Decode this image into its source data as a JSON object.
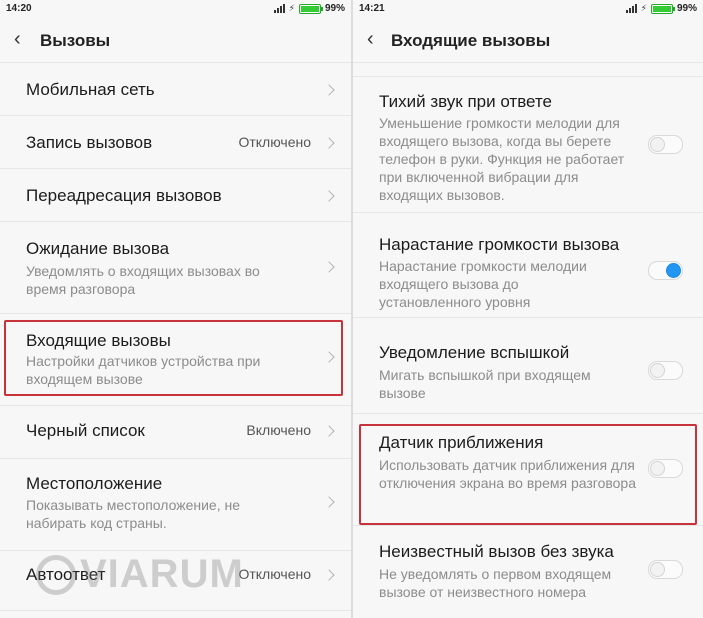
{
  "left_screen": {
    "status": {
      "time": "14:20",
      "battery": "99%"
    },
    "header": {
      "title": "Вызовы"
    },
    "items": [
      {
        "title": "Мобильная сеть"
      },
      {
        "title": "Запись вызовов",
        "value": "Отключено"
      },
      {
        "title": "Переадресация вызовов"
      },
      {
        "title": "Ожидание вызова",
        "subtitle": "Уведомлять о входящих вызовах во время разговора"
      },
      {
        "title": "Входящие вызовы",
        "subtitle": "Настройки датчиков устройства при входящем вызове"
      },
      {
        "title": "Черный список",
        "value": "Включено"
      },
      {
        "title": "Местоположение",
        "subtitle": "Показывать местоположение, не набирать код страны."
      },
      {
        "title": "Автоответ",
        "value": "Отключено"
      }
    ]
  },
  "right_screen": {
    "status": {
      "time": "14:21",
      "battery": "99%"
    },
    "header": {
      "title": "Входящие вызовы"
    },
    "items": [
      {
        "title": "Тихий звук при ответе",
        "subtitle": "Уменьшение громкости мелодии для входящего вызова, когда вы берете телефон в руки. Функция не работает при включенной вибрации для входящих вызовов.",
        "enabled": false
      },
      {
        "title": "Нарастание громкости вызова",
        "subtitle": "Нарастание громкости мелодии входящего вызова до установленного уровня",
        "enabled": true
      },
      {
        "title": "Уведомление вспышкой",
        "subtitle": "Мигать вспышкой при входящем вызове",
        "enabled": false
      },
      {
        "title": "Датчик приближения",
        "subtitle": "Использовать датчик приближения для отключения экрана во время разговора",
        "enabled": false
      },
      {
        "title": "Неизвестный вызов без звука",
        "subtitle": "Не уведомлять о первом входящем вызове от неизвестного номера",
        "enabled": false
      }
    ]
  },
  "colors": {
    "highlight": "#c8323a",
    "toggle_on": "#2196f3"
  },
  "watermark": {
    "text": "VIARUM"
  }
}
